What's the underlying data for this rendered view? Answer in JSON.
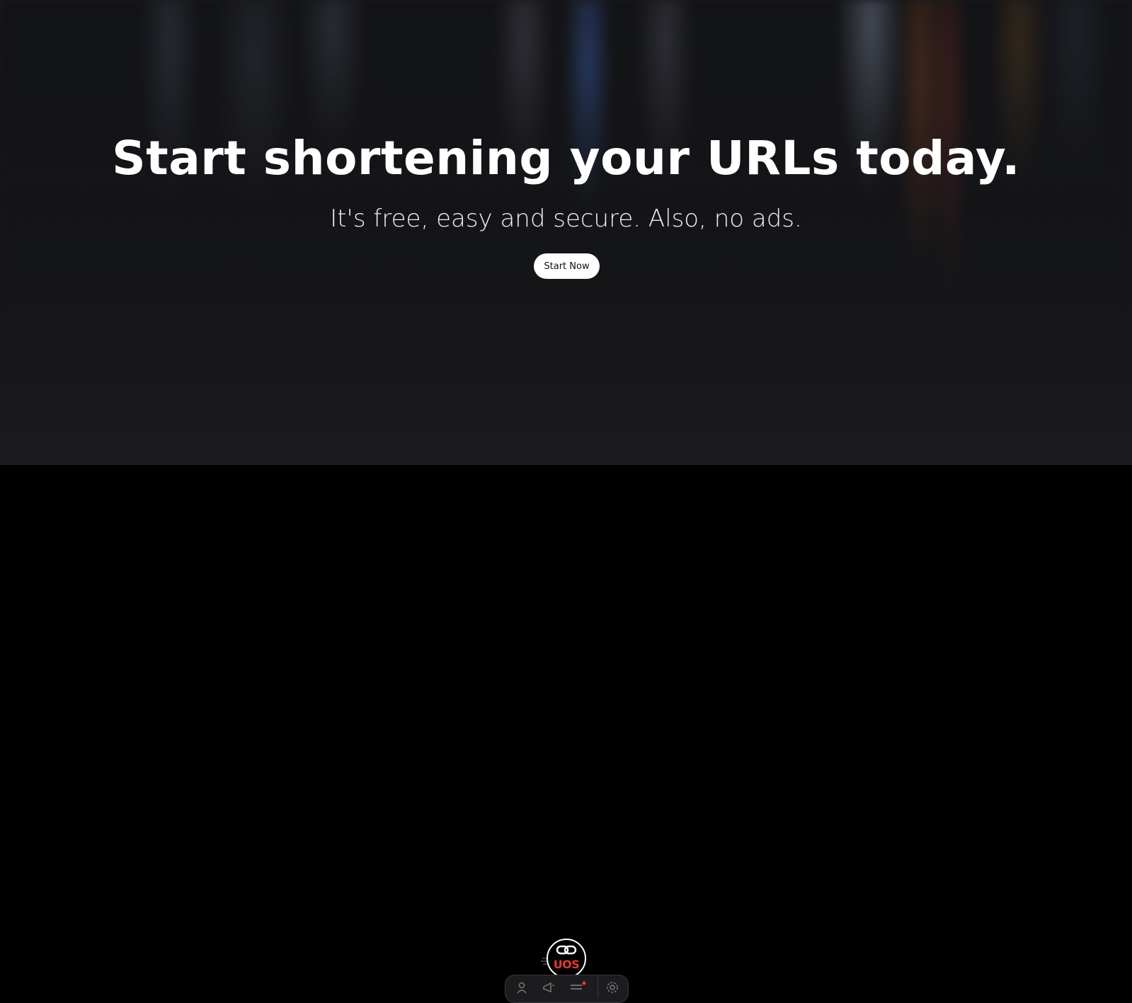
{
  "hero": {
    "headline": "Start shortening your URLs today.",
    "subline": "It's free, easy and secure. Also, no ads.",
    "cta_label": "Start Now"
  },
  "footer": {
    "logo_text": "UOS",
    "dock_icons": [
      "person-icon",
      "megaphone-icon",
      "menu-icon",
      "settings-icon"
    ]
  },
  "colors": {
    "logo_accent": "#e53935",
    "button_bg": "#ffffff",
    "page_bg": "#000000"
  }
}
